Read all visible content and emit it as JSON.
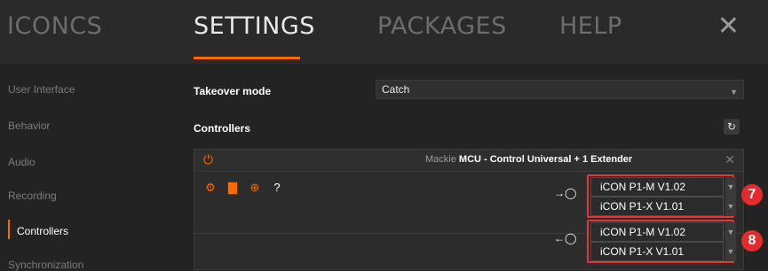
{
  "topbar": {
    "tabs": [
      "ICONCS",
      "SETTINGS",
      "PACKAGES",
      "HELP"
    ],
    "active_tab": "SETTINGS",
    "close_glyph": "✕"
  },
  "sidebar": {
    "items": [
      {
        "label": "User Interface"
      },
      {
        "label": "Behavior"
      },
      {
        "label": "Audio"
      },
      {
        "label": "Recording"
      },
      {
        "label": "Controllers"
      },
      {
        "label": "Synchronization"
      }
    ],
    "active_item": "Controllers"
  },
  "settings": {
    "takeover_label": "Takeover mode",
    "takeover_value": "Catch",
    "controllers_label": "Controllers"
  },
  "controller_panel": {
    "title_prefix": "Mackie",
    "title_main": "MCU - Control Universal + 1 Extender",
    "inputs": [
      "iCON P1-M V1.02",
      "iCON P1-X V1.01"
    ],
    "outputs": [
      "iCON P1-M V1.02",
      "iCON P1-X V1.01"
    ]
  },
  "annotations": {
    "badge_7": "7",
    "badge_8": "8"
  },
  "icons": {
    "power": "power-icon",
    "settings": "gear-icon",
    "comment": "speech-bubble-icon",
    "target": "crosshair-icon",
    "help": "help-icon",
    "refresh": "refresh-icon",
    "close": "close-icon",
    "midi_in": "midi-in-icon",
    "midi_out": "midi-out-icon"
  },
  "colors": {
    "accent": "#ff6a00",
    "badge": "#e32b2b",
    "background": "#232323"
  }
}
